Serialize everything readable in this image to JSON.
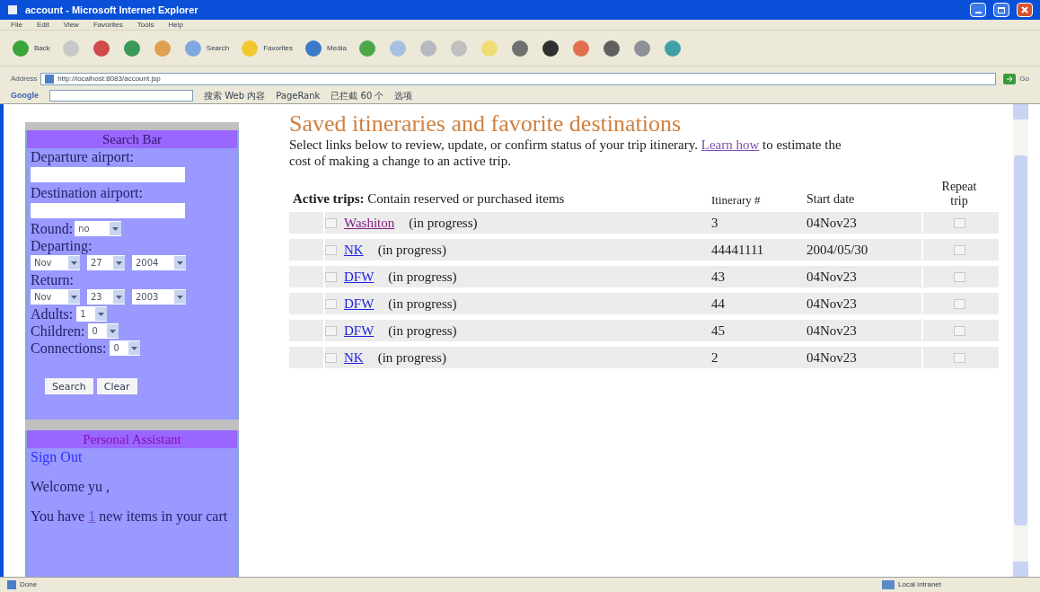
{
  "window": {
    "title": "account - Microsoft Internet Explorer"
  },
  "menu": [
    "File",
    "Edit",
    "View",
    "Favorites",
    "Tools",
    "Help"
  ],
  "toolbar": {
    "back": "Back",
    "search": "Search",
    "favorites": "Favorites",
    "media": "Media"
  },
  "address_bar": {
    "label": "Address",
    "url": "http://localhost:8083/account.jsp",
    "go": "Go"
  },
  "google_bar": {
    "logo": "Google",
    "items": [
      "搜索 Web 内容",
      "PageRank",
      "已拦截 60 个",
      "选项"
    ]
  },
  "search_bar": {
    "title": "Search Bar",
    "fields": [
      {
        "kind": "text",
        "label": "Departure airport:"
      },
      {
        "kind": "text",
        "label": "Destination airport:"
      }
    ],
    "round": {
      "label": "Round:",
      "value": "no"
    },
    "departing": {
      "label": "Departing:",
      "values": [
        "Nov",
        "27",
        "2004"
      ]
    },
    "return": {
      "label": "Return:",
      "values": [
        "Nov",
        "23",
        "2003"
      ]
    },
    "counts": [
      {
        "label": "Adults:",
        "value": "1"
      },
      {
        "label": "Children:",
        "value": "0"
      },
      {
        "label": "Connections:",
        "value": "0"
      }
    ],
    "buttons": [
      "Search",
      "Clear"
    ]
  },
  "assistant": {
    "title": "Personal Assistant",
    "sign_out": "Sign Out",
    "welcome": "Welcome yu ,",
    "cart_before": "You have",
    "cart_count": "1",
    "cart_after": "new items in your cart"
  },
  "main": {
    "title": "Saved itineraries and favorite destinations",
    "intro_before": "Select links below to review, update, or confirm status of your trip itinerary.",
    "intro_link": "Learn how",
    "intro_after": "to estimate the cost of making a change to an active trip.",
    "table": {
      "columns": [
        "**Active trips:** Contain reserved or purchased items",
        "Itinerary #",
        "Start date",
        "Repeat trip"
      ],
      "rows": [
        {
          "name": "Washiton",
          "status": "(in progress)",
          "itinerary": "3",
          "start": "04Nov23",
          "visited": true,
          "checked": false,
          "repeat": false
        },
        {
          "name": "NK",
          "status": "(in progress)",
          "itinerary": "44441111",
          "start": "2004/05/30",
          "visited": false,
          "checked": false,
          "repeat": false
        },
        {
          "name": "DFW",
          "status": "(in progress)",
          "itinerary": "43",
          "start": "04Nov23",
          "visited": false,
          "checked": false,
          "repeat": false
        },
        {
          "name": "DFW",
          "status": "(in progress)",
          "itinerary": "44",
          "start": "04Nov23",
          "visited": false,
          "checked": false,
          "repeat": false
        },
        {
          "name": "DFW",
          "status": "(in progress)",
          "itinerary": "45",
          "start": "04Nov23",
          "visited": false,
          "checked": false,
          "repeat": false
        },
        {
          "name": "NK",
          "status": "(in progress)",
          "itinerary": "2",
          "start": "04Nov23",
          "visited": false,
          "checked": false,
          "repeat": false
        }
      ]
    }
  },
  "status_bar": {
    "text": "Done",
    "zone": "Local intranet"
  }
}
